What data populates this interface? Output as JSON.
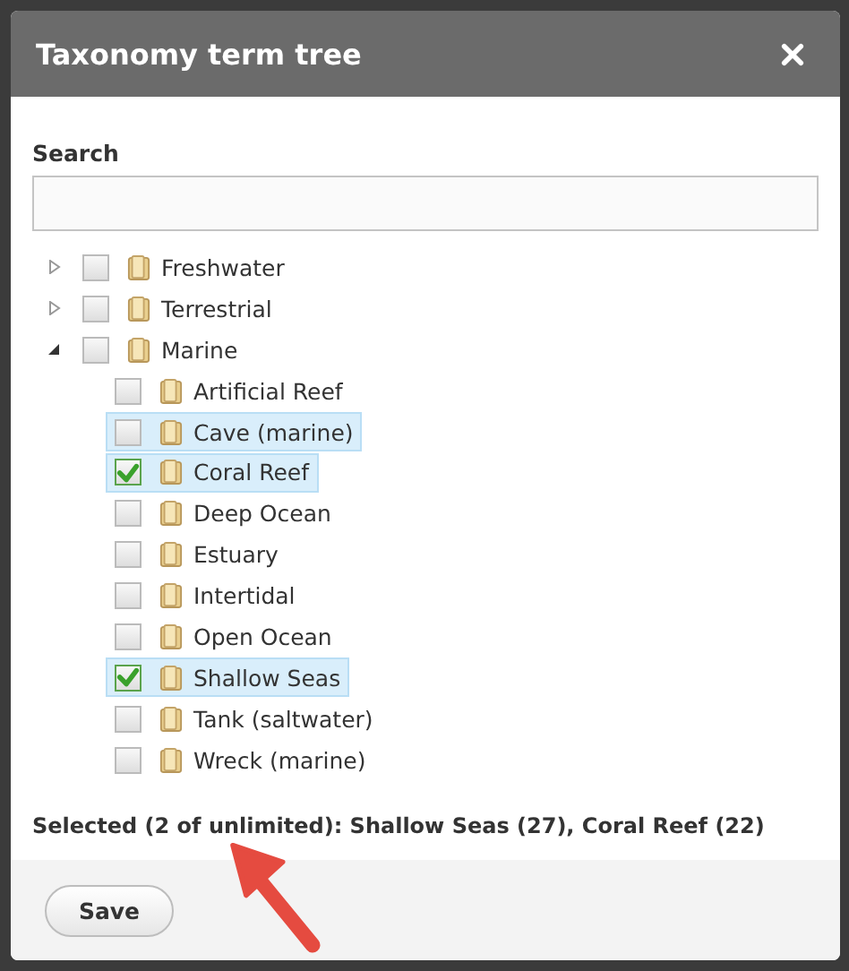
{
  "dialog": {
    "title": "Taxonomy term tree"
  },
  "search": {
    "label": "Search"
  },
  "tree": [
    {
      "label": "Freshwater",
      "expanded": false,
      "checked": false,
      "highlighted": false
    },
    {
      "label": "Terrestrial",
      "expanded": false,
      "checked": false,
      "highlighted": false
    },
    {
      "label": "Marine",
      "expanded": true,
      "checked": false,
      "highlighted": false,
      "children": [
        {
          "label": "Artificial Reef",
          "checked": false,
          "highlighted": false
        },
        {
          "label": "Cave (marine)",
          "checked": false,
          "highlighted": true
        },
        {
          "label": "Coral Reef",
          "checked": true,
          "highlighted": true
        },
        {
          "label": "Deep Ocean",
          "checked": false,
          "highlighted": false
        },
        {
          "label": "Estuary",
          "checked": false,
          "highlighted": false
        },
        {
          "label": "Intertidal",
          "checked": false,
          "highlighted": false
        },
        {
          "label": "Open Ocean",
          "checked": false,
          "highlighted": false
        },
        {
          "label": "Shallow Seas",
          "checked": true,
          "highlighted": true
        },
        {
          "label": "Tank (saltwater)",
          "checked": false,
          "highlighted": false
        },
        {
          "label": "Wreck (marine)",
          "checked": false,
          "highlighted": false
        }
      ]
    }
  ],
  "selection_summary": "Selected (2 of unlimited): Shallow Seas (27), Coral Reef (22)",
  "buttons": [
    "Save"
  ]
}
